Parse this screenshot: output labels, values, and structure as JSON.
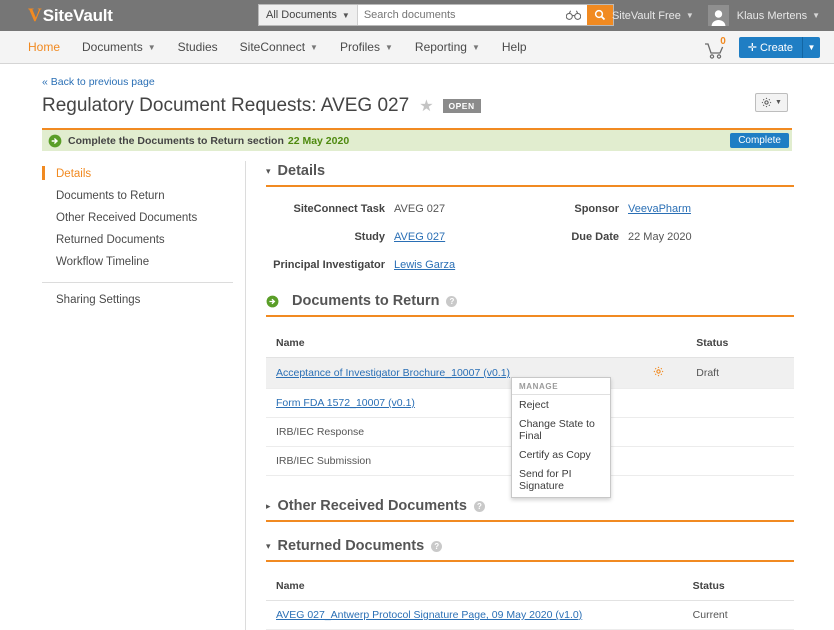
{
  "topbar": {
    "logo_mark": "V",
    "logo_text": "SiteVault",
    "search": {
      "scope_label": "All Documents",
      "placeholder": "Search documents",
      "value": "",
      "binoculars_icon": "binoculars-icon",
      "search_icon": "search-icon"
    },
    "vault_selector": "SiteVault Free",
    "user_name": "Klaus Mertens"
  },
  "nav": {
    "items": [
      {
        "label": "Home",
        "has_caret": false,
        "active": true
      },
      {
        "label": "Documents",
        "has_caret": true,
        "active": false
      },
      {
        "label": "Studies",
        "has_caret": false,
        "active": false
      },
      {
        "label": "SiteConnect",
        "has_caret": true,
        "active": false
      },
      {
        "label": "Profiles",
        "has_caret": true,
        "active": false
      },
      {
        "label": "Reporting",
        "has_caret": true,
        "active": false
      },
      {
        "label": "Help",
        "has_caret": false,
        "active": false
      }
    ],
    "cart_count": "0",
    "create_label": "Create"
  },
  "page": {
    "back_link": "« Back to previous page",
    "title": "Regulatory Document Requests: AVEG 027",
    "status_badge": "OPEN",
    "gear_menu_label": "actions"
  },
  "alert": {
    "text": "Complete the Documents to Return section",
    "date": "22 May 2020",
    "button_label": "Complete"
  },
  "sidebar": {
    "items": [
      {
        "label": "Details",
        "active": true
      },
      {
        "label": "Documents to Return",
        "active": false
      },
      {
        "label": "Other Received Documents",
        "active": false
      },
      {
        "label": "Returned Documents",
        "active": false
      },
      {
        "label": "Workflow Timeline",
        "active": false
      }
    ],
    "secondary": [
      {
        "label": "Sharing Settings"
      }
    ]
  },
  "details": {
    "section_title": "Details",
    "toggle": "▾",
    "left_fields": [
      {
        "label": "SiteConnect Task",
        "value": "AVEG 027",
        "link": false
      },
      {
        "label": "Study",
        "value": "AVEG 027",
        "link": true
      },
      {
        "label": "Principal Investigator",
        "value": "Lewis Garza",
        "link": true
      }
    ],
    "right_fields": [
      {
        "label": "Sponsor",
        "value": "VeevaPharm",
        "link": true
      },
      {
        "label": "Due Date",
        "value": "22 May 2020",
        "link": false
      }
    ]
  },
  "documents_to_return": {
    "section_title": "Documents to Return",
    "toggle": "▸",
    "help": "?",
    "columns": [
      "Name",
      "Status"
    ],
    "rows": [
      {
        "name": "Acceptance of Investigator Brochure_10007 (v0.1)",
        "link": true,
        "status": "Draft",
        "gear": true,
        "highlighted": true
      },
      {
        "name": "Form FDA 1572_10007 (v0.1)",
        "link": true,
        "status": "",
        "gear": false,
        "highlighted": false
      },
      {
        "name": "IRB/IEC Response",
        "link": false,
        "status": "",
        "gear": false,
        "highlighted": false
      },
      {
        "name": "IRB/IEC Submission",
        "link": false,
        "status": "",
        "gear": false,
        "highlighted": false
      }
    ],
    "context_menu": {
      "header": "MANAGE",
      "items": [
        "Reject",
        "Change State to Final",
        "Certify as Copy",
        "Send for PI Signature"
      ]
    }
  },
  "other_received_documents": {
    "section_title": "Other Received Documents",
    "toggle": "▸",
    "help": "?"
  },
  "returned_documents": {
    "section_title": "Returned Documents",
    "toggle": "▾",
    "help": "?",
    "columns": [
      "Name",
      "Status"
    ],
    "rows": [
      {
        "name": "AVEG 027_Antwerp Protocol Signature Page, 09 May 2020 (v1.0)",
        "link": true,
        "status": "Current"
      }
    ]
  },
  "colors": {
    "brand_orange": "#f18a21",
    "link_blue": "#2a6fb5",
    "button_blue": "#1f7ec4",
    "topbar_gray": "#767676",
    "alert_green_bg": "#e1edcf",
    "alert_green_text": "#4f8a10"
  }
}
